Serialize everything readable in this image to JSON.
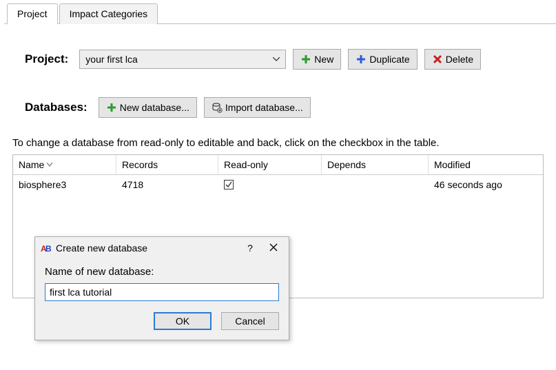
{
  "tabs": {
    "project": "Project",
    "impact": "Impact Categories"
  },
  "project": {
    "label": "Project:",
    "selected": "your first lca",
    "new_btn": "New",
    "duplicate_btn": "Duplicate",
    "delete_btn": "Delete"
  },
  "databases": {
    "label": "Databases:",
    "new_db_btn": "New database...",
    "import_db_btn": "Import database..."
  },
  "hint": "To change a database from read-only to editable and back, click on the checkbox in the table.",
  "table": {
    "headers": {
      "name": "Name",
      "records": "Records",
      "readonly": "Read-only",
      "depends": "Depends",
      "modified": "Modified"
    },
    "rows": [
      {
        "name": "biosphere3",
        "records": "4718",
        "readonly": true,
        "depends": "",
        "modified": "46 seconds ago"
      }
    ]
  },
  "dialog": {
    "title": "Create new database",
    "help": "?",
    "label": "Name of new database:",
    "input_value": "first lca tutorial",
    "ok": "OK",
    "cancel": "Cancel"
  }
}
